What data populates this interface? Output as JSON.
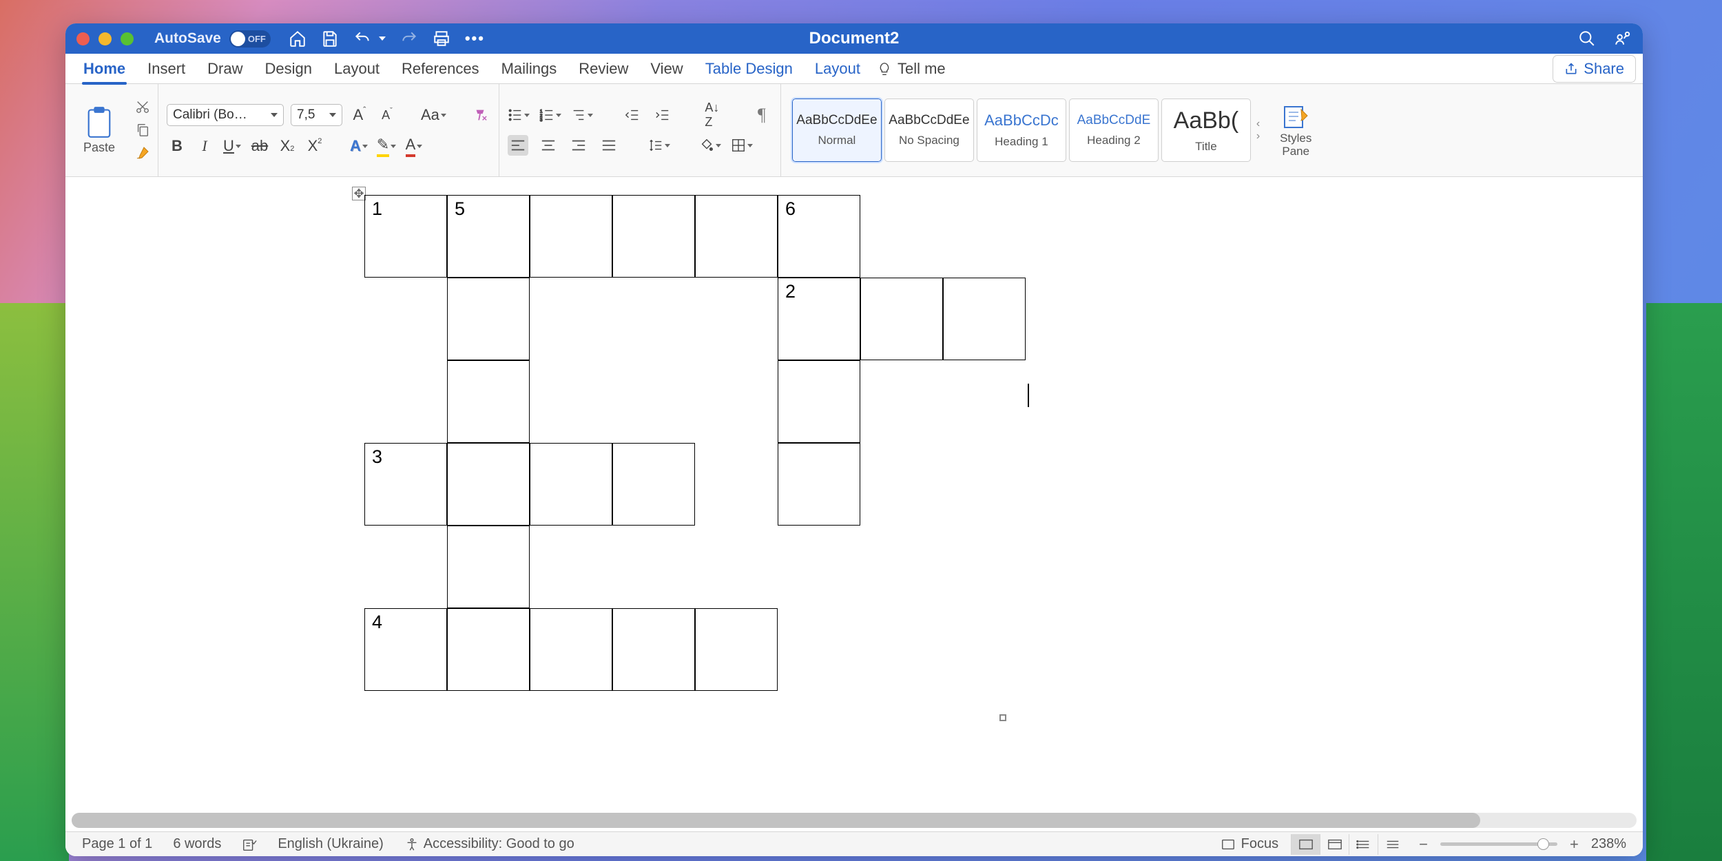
{
  "titlebar": {
    "autosave_label": "AutoSave",
    "autosave_state": "OFF",
    "document_title": "Document2"
  },
  "tabs": {
    "home": "Home",
    "insert": "Insert",
    "draw": "Draw",
    "design": "Design",
    "layout": "Layout",
    "references": "References",
    "mailings": "Mailings",
    "review": "Review",
    "view": "View",
    "table_design": "Table Design",
    "layout2": "Layout",
    "tell_me": "Tell me",
    "share": "Share"
  },
  "ribbon": {
    "paste": "Paste",
    "font_name": "Calibri (Bo…",
    "font_size": "7,5",
    "styles_pane": "Styles\nPane",
    "styles": {
      "normal": {
        "preview": "AaBbCcDdEe",
        "name": "Normal"
      },
      "nospacing": {
        "preview": "AaBbCcDdEe",
        "name": "No Spacing"
      },
      "heading1": {
        "preview": "AaBbCcDc",
        "name": "Heading 1"
      },
      "heading2": {
        "preview": "AaBbCcDdE",
        "name": "Heading 2"
      },
      "title": {
        "preview": "AaBb(",
        "name": "Title"
      }
    }
  },
  "crossword": {
    "n1": "1",
    "n5": "5",
    "n6": "6",
    "n2": "2",
    "n3": "3",
    "n4": "4"
  },
  "status": {
    "page": "Page 1 of 1",
    "words": "6 words",
    "language": "English (Ukraine)",
    "accessibility": "Accessibility: Good to go",
    "focus": "Focus",
    "zoom": "238%"
  }
}
